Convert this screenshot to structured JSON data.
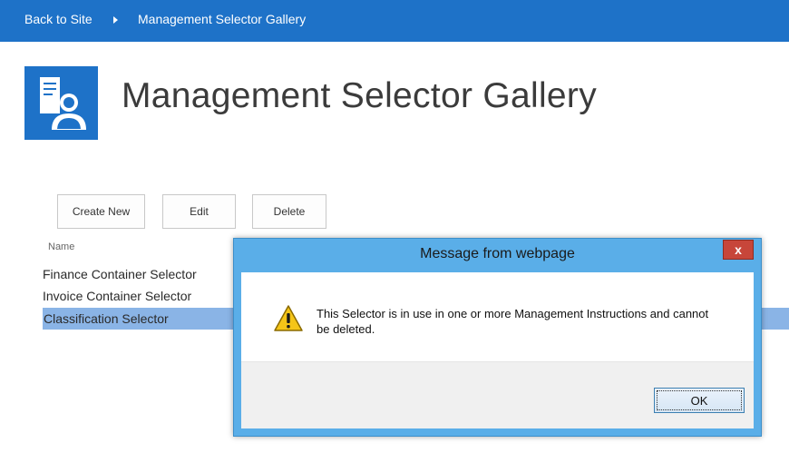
{
  "breadcrumb": {
    "back": "Back to Site",
    "current": "Management Selector Gallery"
  },
  "header": {
    "title": "Management Selector Gallery",
    "logo_icon": "document-person-icon"
  },
  "toolbar": {
    "create_label": "Create New",
    "edit_label": "Edit",
    "delete_label": "Delete"
  },
  "list": {
    "column_header": "Name",
    "items": [
      {
        "label": "Finance Container Selector",
        "selected": false
      },
      {
        "label": "Invoice Container Selector",
        "selected": false
      },
      {
        "label": "Classification Selector",
        "selected": true
      }
    ]
  },
  "dialog": {
    "title": "Message from webpage",
    "close_label": "x",
    "icon": "warning-icon",
    "message": "This Selector is in use in one or more Management Instructions and cannot be deleted.",
    "ok_label": "OK"
  },
  "colors": {
    "accent": "#1e72c8",
    "selection": "#8ab4e6",
    "dialog_frame": "#5aaee8",
    "close_button": "#c7463a"
  }
}
